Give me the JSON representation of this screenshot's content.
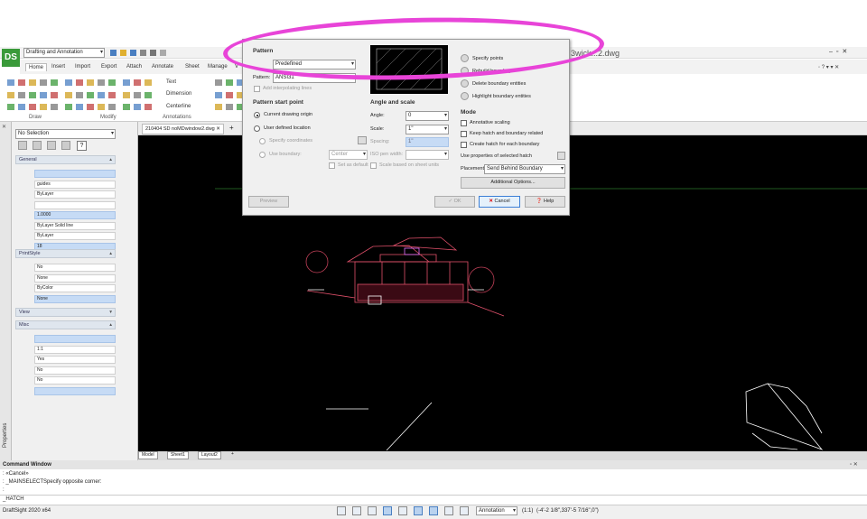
{
  "window": {
    "workspace": "Drafting and Annotation",
    "file_title": "3wick...2.dwg",
    "app_name": "DraftSight 2020 x64",
    "logo_text": "DS"
  },
  "ribbon": {
    "tabs": [
      "Home",
      "Insert",
      "Import",
      "Export",
      "Attach",
      "Annotate",
      "Sheet",
      "Manage",
      "V"
    ],
    "active_tab": "Home",
    "groups": [
      "Draw",
      "Modify",
      "Annotations"
    ],
    "annotation_tools": [
      "Text",
      "Dimension",
      "Centerline"
    ]
  },
  "doc_tab": {
    "name": "210404 SD noMDwindow2.dwg",
    "add": "+"
  },
  "properties": {
    "selection": "No Selection",
    "vertical_title": "Properties",
    "help_icon": "?",
    "sections": {
      "general": "General",
      "printstyle": "PrintStyle",
      "view": "View",
      "misc": "Misc"
    },
    "general_values": [
      "",
      "guides",
      "ByLayer",
      "",
      "1.0000",
      "ByLayer   Solid line",
      "ByLayer",
      "18"
    ],
    "printstyle_values": [
      "No",
      "None",
      "ByColor",
      "None"
    ],
    "misc_values": [
      "",
      "1:1",
      "Yes",
      "No",
      "No",
      ""
    ]
  },
  "layout_tabs": [
    "Model",
    "Sheet1",
    "Layout2"
  ],
  "layout_add": "+",
  "command": {
    "title": "Command Window",
    "lines": [
      ": «Cancel»",
      ": _MAINSELECTSpecify opposite corner:",
      ":"
    ],
    "input": "_HATCH"
  },
  "status": {
    "annotation_label": "Annotation",
    "scale": "(1:1)",
    "coords": "(-4'-2 1/8\",337'-5 7/16\",0\")"
  },
  "hatch_dialog": {
    "pattern_heading": "Pattern",
    "type_value": "Predefined",
    "pattern_label": "Pattern:",
    "pattern_value": "ANSI31",
    "add_interpolate_label": "Add interpolating lines",
    "start_point_heading": "Pattern start point",
    "current_origin_label": "Current drawing origin",
    "user_defined_label": "User defined location",
    "specify_coords_label": "Specify coordinates",
    "use_boundary_label": "Use boundary:",
    "boundary_value": "Center",
    "set_default_label": "Set as default",
    "scale_sheet_label": "Scale based on sheet units",
    "angle_scale_heading": "Angle and scale",
    "angle_label": "Angle:",
    "angle_value": "0",
    "scale_label": "Scale:",
    "scale_value": "1\"",
    "spacing_label": "Spacing:",
    "spacing_value": "1\"",
    "iso_label": "ISO pen width:",
    "boundary_items": [
      "Specify points",
      "Rebuild boundary",
      "Delete boundary entities",
      "Highlight boundary entities"
    ],
    "mode_heading": "Mode",
    "annotative_label": "Annotative scaling",
    "keep_hatch_label": "Keep hatch and boundary related",
    "create_each_label": "Create hatch for each boundary",
    "use_props_label": "Use properties of selected hatch",
    "placement_label": "Placement:",
    "placement_value": "Send Behind Boundary",
    "additional_label": "Additional Options...",
    "preview_label": "Preview",
    "ok_label": "OK",
    "cancel_label": "Cancel",
    "help_label": "Help"
  },
  "colors": {
    "annotation_circle": "#e844d8",
    "canvas": "#000000",
    "selection_blue": "#c6dbf5",
    "drawing_red": "#e0506a",
    "drawing_magenta": "#e070ff"
  }
}
